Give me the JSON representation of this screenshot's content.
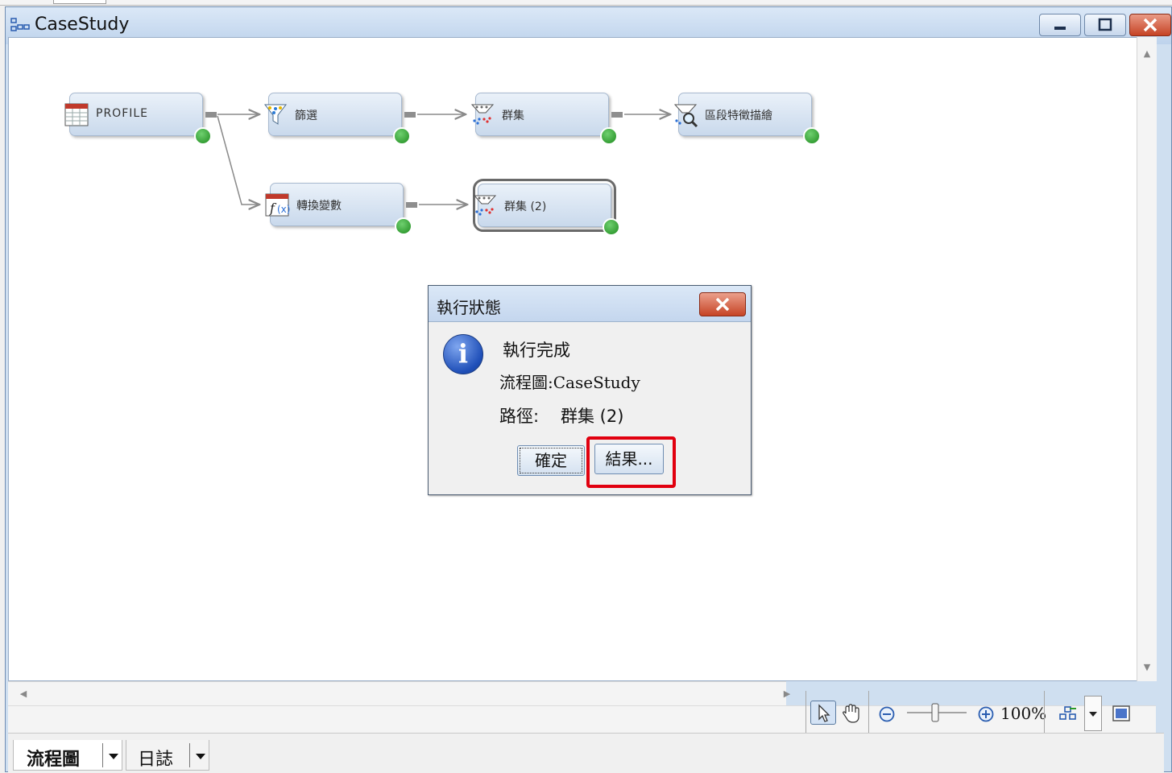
{
  "window": {
    "title": "CaseStudy",
    "controls": {
      "minimize": "minimize-icon",
      "maximize": "maximize-icon",
      "close": "close-icon"
    }
  },
  "diagram": {
    "nodes": [
      {
        "id": "profile",
        "label": "PROFILE",
        "icon": "data-source-icon",
        "status": "completed"
      },
      {
        "id": "filter",
        "label": "篩選",
        "icon": "filter-icon",
        "status": "completed"
      },
      {
        "id": "cluster",
        "label": "群集",
        "icon": "cluster-icon",
        "status": "completed"
      },
      {
        "id": "segment-profile",
        "label": "區段特徵描繪",
        "icon": "segment-profile-icon",
        "status": "completed"
      },
      {
        "id": "transform",
        "label": "轉換變數",
        "icon": "transform-variables-icon",
        "status": "completed"
      },
      {
        "id": "cluster2",
        "label": "群集 (2)",
        "icon": "cluster-icon",
        "status": "completed"
      }
    ]
  },
  "dialog": {
    "title": "執行狀態",
    "message": "執行完成",
    "diagram_line": "流程圖:CaseStudy",
    "path_label": "路徑:",
    "path_value": "群集 (2)",
    "ok_label": "確定",
    "results_label": "結果..."
  },
  "toolbar": {
    "zoom": "100%",
    "tools": [
      "select-pointer-icon",
      "pan-hand-icon",
      "zoom-out-icon",
      "zoom-slider",
      "zoom-in-icon",
      "auto-layout-icon",
      "fit-to-window-icon"
    ]
  },
  "bottom_tabs": [
    {
      "label": "流程圖",
      "active": true
    },
    {
      "label": "日誌",
      "active": false
    }
  ]
}
